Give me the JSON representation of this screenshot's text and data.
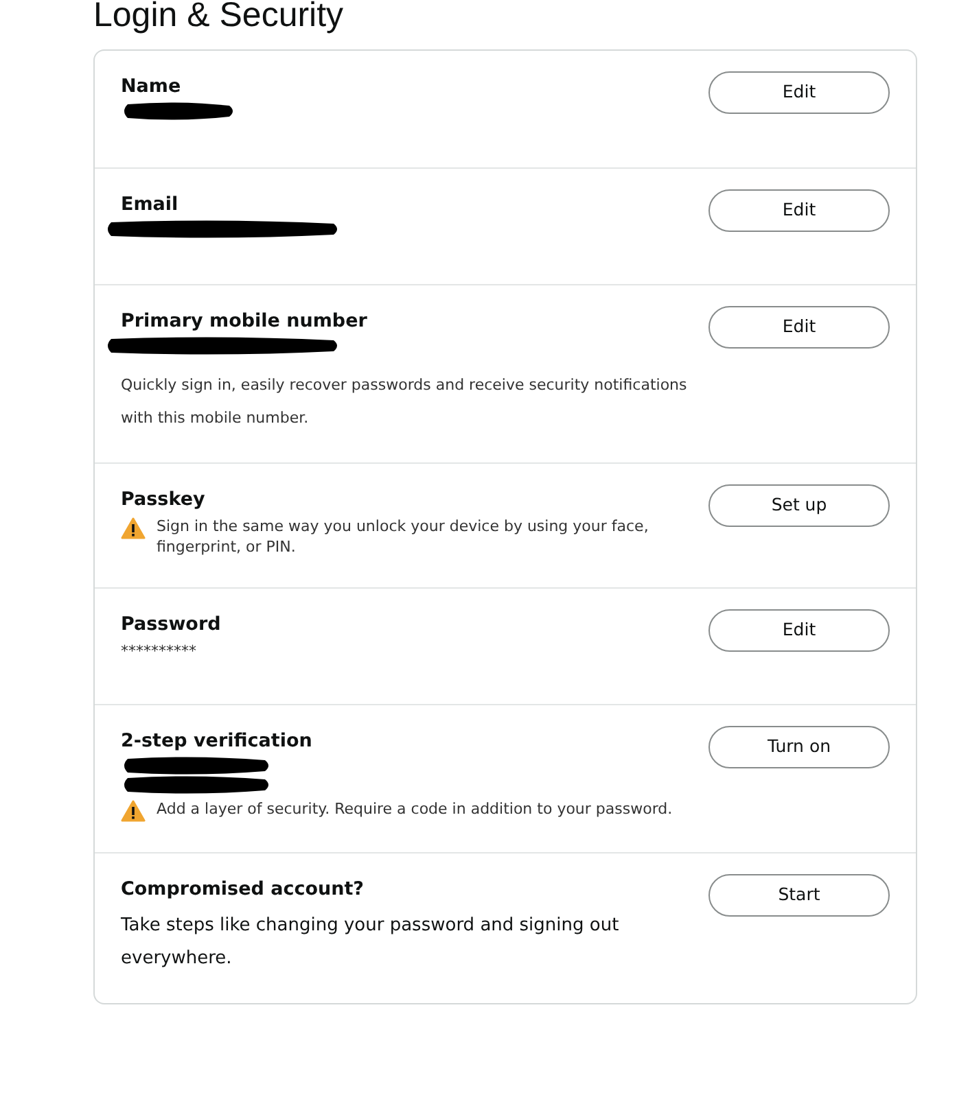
{
  "heading": "Login & Security",
  "rows": [
    {
      "kind": "redacted",
      "title": "Name",
      "button": "Edit"
    },
    {
      "kind": "contact",
      "title": "Email",
      "button": "Edit"
    },
    {
      "kind": "contact",
      "title": "Primary mobile number",
      "button": "Edit",
      "note": "Quickly sign in, easily recover passwords and receive security notifications with this mobile number."
    },
    {
      "kind": "warning",
      "title": "Passkey",
      "button": "Set up",
      "note": "Sign in the same way you unlock your device by using your face, fingerprint, or PIN."
    },
    {
      "kind": "masked",
      "title": "Password",
      "button": "Edit",
      "value": "**********"
    },
    {
      "kind": "twostep",
      "title": "2-step verification",
      "button": "Turn on",
      "note": "Add a layer of security. Require a code in addition to your password."
    },
    {
      "kind": "info",
      "title": "Compromised account?",
      "button": "Start",
      "note": "Take steps like changing your password and signing out everywhere."
    }
  ]
}
